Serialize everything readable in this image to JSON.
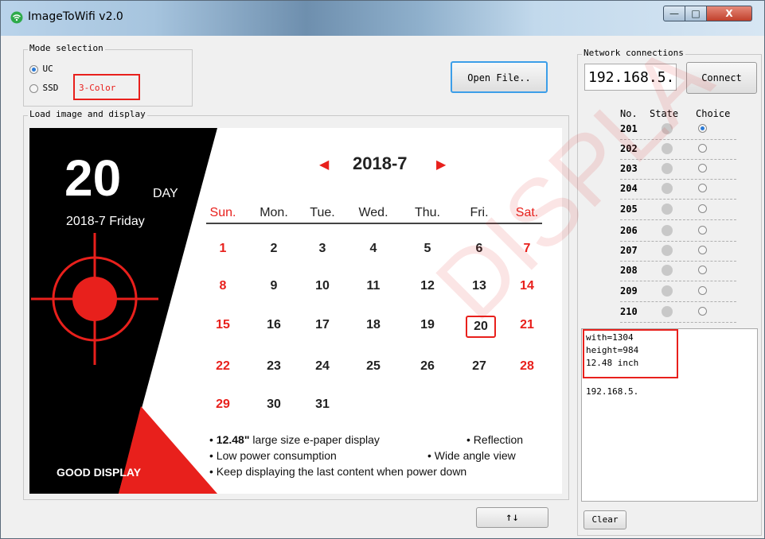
{
  "window": {
    "title": "ImageToWifi v2.0",
    "min": "—",
    "max": "□",
    "close": "X"
  },
  "mode": {
    "label": "Mode selection",
    "option_uc": "UC",
    "option_ssd": "SSD",
    "three_color": "3-Color"
  },
  "open_file": "Open File..",
  "load_label": "Load image and display",
  "arrows_button": "↑↓",
  "network": {
    "label": "Network connections",
    "ip_value": "192.168.5.",
    "connect": "Connect",
    "col_no": "No.",
    "col_state": "State",
    "col_choice": "Choice",
    "rows": [
      "201",
      "202",
      "203",
      "204",
      "205",
      "206",
      "207",
      "208",
      "209",
      "210"
    ],
    "selected_row": "201"
  },
  "log": {
    "line1": "with=1304",
    "line2": "height=984",
    "line3": "12.48 inch",
    "ip": "192.168.5."
  },
  "clear": "Clear",
  "calendar": {
    "day_big": "20",
    "day_word": "DAY",
    "date_line": "2018-7 Friday",
    "month": "2018-7",
    "prev": "◀",
    "next": "▶",
    "headers": [
      "Sun.",
      "Mon.",
      "Tue.",
      "Wed.",
      "Thu.",
      "Fri.",
      "Sat."
    ],
    "weeks": [
      [
        "1",
        "2",
        "3",
        "4",
        "5",
        "6",
        "7"
      ],
      [
        "8",
        "9",
        "10",
        "11",
        "12",
        "13",
        "14"
      ],
      [
        "15",
        "16",
        "17",
        "18",
        "19",
        "20",
        "21"
      ],
      [
        "22",
        "23",
        "24",
        "25",
        "26",
        "27",
        "28"
      ],
      [
        "29",
        "30",
        "31",
        "",
        "",
        "",
        ""
      ]
    ],
    "highlight_day": "20",
    "feature1_size": "12.48\"",
    "feature1_text": " large size e-paper display",
    "feature1_right": "• Reflection",
    "feature2": "• Low power consumption",
    "feature2_right": "• Wide angle view",
    "feature3": "• Keep displaying the last content when power down",
    "brand_good": "GOOD ",
    "brand_display": "DISPLAY",
    "colors": {
      "red": "#e8201c",
      "black": "#000000"
    }
  },
  "watermark": "DISPLA"
}
